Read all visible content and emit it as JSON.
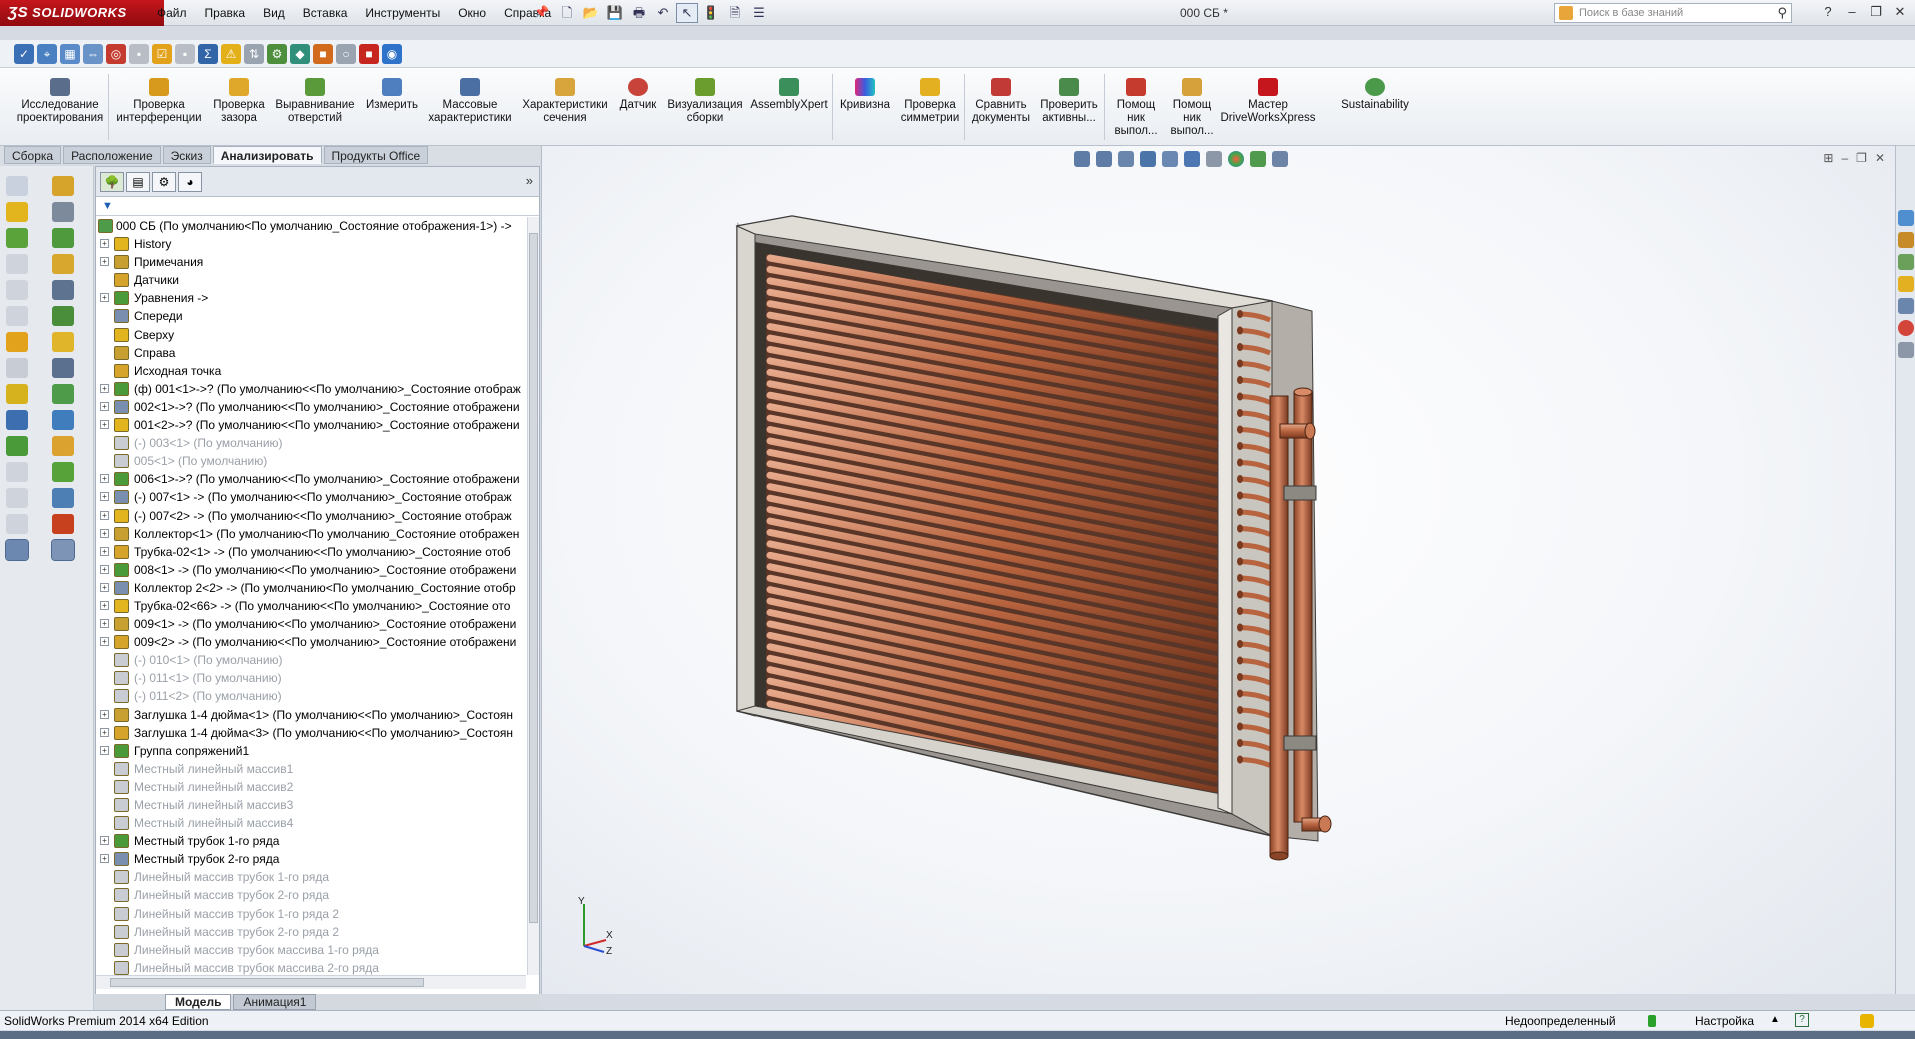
{
  "app": {
    "brand": "SOLIDWORKS",
    "doc_title": "000 СБ *",
    "edition": "SolidWorks Premium 2014 x64 Edition"
  },
  "menu": [
    "Файл",
    "Правка",
    "Вид",
    "Вставка",
    "Инструменты",
    "Окно",
    "Справка"
  ],
  "search": {
    "placeholder": "Поиск в базе знаний"
  },
  "ribbon": {
    "buttons": [
      "Исследование проектирования",
      "Проверка интерференции",
      "Проверка зазора",
      "Выравнивание отверстий",
      "Измерить",
      "Массовые характеристики",
      "Характеристики сечения",
      "Датчик",
      "Визуализация сборки",
      "AssemblyXpert",
      "Кривизна",
      "Проверка симметрии",
      "Сравнить документы",
      "Проверить активны...",
      "Помощ ник выпол...",
      "Помощ ник выпол...",
      "Мастер DriveWorksXpress",
      "Sustainability"
    ]
  },
  "cm_tabs": [
    "Сборка",
    "Расположение",
    "Эскиз",
    "Анализировать",
    "Продукты Office"
  ],
  "cm_active_tab": "Анализировать",
  "tree": {
    "root": "000 СБ  (По умолчанию<По умолчанию_Состояние отображения-1>) ->",
    "items": [
      {
        "label": "History",
        "dim": false,
        "exp": true
      },
      {
        "label": "Примечания",
        "dim": false,
        "exp": true
      },
      {
        "label": "Датчики",
        "dim": false,
        "exp": false
      },
      {
        "label": "Уравнения ->",
        "dim": false,
        "exp": true
      },
      {
        "label": "Спереди",
        "dim": false,
        "exp": false
      },
      {
        "label": "Сверху",
        "dim": false,
        "exp": false
      },
      {
        "label": "Справа",
        "dim": false,
        "exp": false
      },
      {
        "label": "Исходная точка",
        "dim": false,
        "exp": false
      },
      {
        "label": "(ф) 001<1>->? (По умолчанию<<По умолчанию>_Состояние отображ",
        "dim": false,
        "exp": true
      },
      {
        "label": "002<1>->? (По умолчанию<<По умолчанию>_Состояние отображени",
        "dim": false,
        "exp": true
      },
      {
        "label": "001<2>->? (По умолчанию<<По умолчанию>_Состояние отображени",
        "dim": false,
        "exp": true
      },
      {
        "label": "(-) 003<1> (По умолчанию)",
        "dim": true,
        "exp": false
      },
      {
        "label": "005<1> (По умолчанию)",
        "dim": true,
        "exp": false
      },
      {
        "label": "006<1>->? (По умолчанию<<По умолчанию>_Состояние отображени",
        "dim": false,
        "exp": true
      },
      {
        "label": "(-) 007<1> -> (По умолчанию<<По умолчанию>_Состояние отображ",
        "dim": false,
        "exp": true
      },
      {
        "label": "(-) 007<2> -> (По умолчанию<<По умолчанию>_Состояние отображ",
        "dim": false,
        "exp": true
      },
      {
        "label": "Коллектор<1> (По умолчанию<По умолчанию_Состояние отображен",
        "dim": false,
        "exp": true
      },
      {
        "label": "Трубка-02<1> -> (По умолчанию<<По умолчанию>_Состояние отоб",
        "dim": false,
        "exp": true
      },
      {
        "label": "008<1> -> (По умолчанию<<По умолчанию>_Состояние отображени",
        "dim": false,
        "exp": true
      },
      {
        "label": "Коллектор 2<2> -> (По умолчанию<По умолчанию_Состояние отобр",
        "dim": false,
        "exp": true
      },
      {
        "label": "Трубка-02<66> -> (По умолчанию<<По умолчанию>_Состояние ото",
        "dim": false,
        "exp": true
      },
      {
        "label": "009<1> -> (По умолчанию<<По умолчанию>_Состояние отображени",
        "dim": false,
        "exp": true
      },
      {
        "label": "009<2> -> (По умолчанию<<По умолчанию>_Состояние отображени",
        "dim": false,
        "exp": true
      },
      {
        "label": "(-) 010<1> (По умолчанию)",
        "dim": true,
        "exp": false
      },
      {
        "label": "(-) 011<1> (По умолчанию)",
        "dim": true,
        "exp": false
      },
      {
        "label": "(-) 011<2> (По умолчанию)",
        "dim": true,
        "exp": false
      },
      {
        "label": "Заглушка 1-4 дюйма<1> (По умолчанию<<По умолчанию>_Состоян",
        "dim": false,
        "exp": true
      },
      {
        "label": "Заглушка 1-4 дюйма<3> (По умолчанию<<По умолчанию>_Состоян",
        "dim": false,
        "exp": true
      },
      {
        "label": "Группа сопряжений1",
        "dim": false,
        "exp": true
      },
      {
        "label": "Местный линейный массив1",
        "dim": true,
        "exp": false
      },
      {
        "label": "Местный линейный массив2",
        "dim": true,
        "exp": false
      },
      {
        "label": "Местный линейный массив3",
        "dim": true,
        "exp": false
      },
      {
        "label": "Местный линейный массив4",
        "dim": true,
        "exp": false
      },
      {
        "label": "Местный трубок 1-го ряда",
        "dim": false,
        "exp": true
      },
      {
        "label": "Местный трубок 2-го ряда",
        "dim": false,
        "exp": true
      },
      {
        "label": "Линейный массив трубок 1-го ряда",
        "dim": true,
        "exp": false
      },
      {
        "label": "Линейный массив трубок 2-го ряда",
        "dim": true,
        "exp": false
      },
      {
        "label": "Линейный массив трубок 1-го ряда 2",
        "dim": true,
        "exp": false
      },
      {
        "label": "Линейный массив трубок 2-го ряда 2",
        "dim": true,
        "exp": false
      },
      {
        "label": "Линейный массив трубок массива 1-го ряда",
        "dim": true,
        "exp": false
      },
      {
        "label": "Линейный массив трубок массива 2-го ряда",
        "dim": true,
        "exp": false
      }
    ]
  },
  "model_tabs": [
    "Модель",
    "Анимация1"
  ],
  "model_active_tab": "Модель",
  "status": {
    "state": "Недоопределенный",
    "units": "Настройка"
  },
  "triad": {
    "x": "X",
    "y": "Y",
    "z": "Z"
  },
  "colors": {
    "brand_red": "#c4161c",
    "copper": "#b8643f",
    "frame": "#d9d6d0"
  }
}
